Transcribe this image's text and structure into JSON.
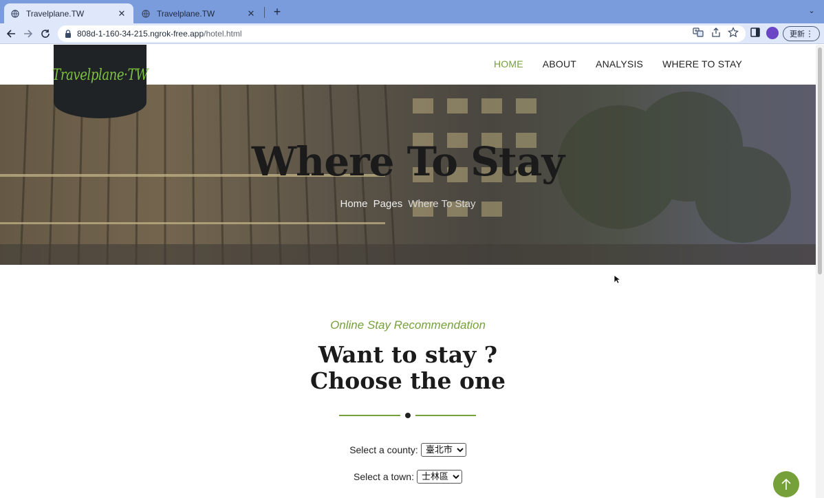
{
  "browser": {
    "tabs": [
      {
        "label": "Travelplane.TW",
        "active": true
      },
      {
        "label": "Travelplane.TW",
        "active": false
      }
    ],
    "url_host": "808d-1-160-34-215.ngrok-free.app",
    "url_path": "/hotel.html",
    "update_label": "更新",
    "icons": [
      "back-icon",
      "forward-icon",
      "reload-icon",
      "lock-icon",
      "translate-icon",
      "share-icon",
      "star-icon",
      "sidebar-icon",
      "profile-avatar",
      "kebab-menu-icon"
    ]
  },
  "site": {
    "logo_text": "Travelplane·TW",
    "nav": [
      {
        "label": "HOME",
        "active": true
      },
      {
        "label": "ABOUT",
        "active": false
      },
      {
        "label": "ANALYSIS",
        "active": false
      },
      {
        "label": "WHERE TO STAY",
        "active": false
      }
    ],
    "accent_color": "#76a03a"
  },
  "hero": {
    "title": "Where To Stay",
    "breadcrumb": [
      "Home",
      "Pages",
      "Where To Stay"
    ]
  },
  "section": {
    "subtitle": "Online Stay Recommendation",
    "heading_line1": "Want to stay ?",
    "heading_line2": "Choose the one"
  },
  "form": {
    "county_label": "Select a county:",
    "county_value": "臺北市",
    "town_label": "Select a town:",
    "town_value": "士林區"
  }
}
